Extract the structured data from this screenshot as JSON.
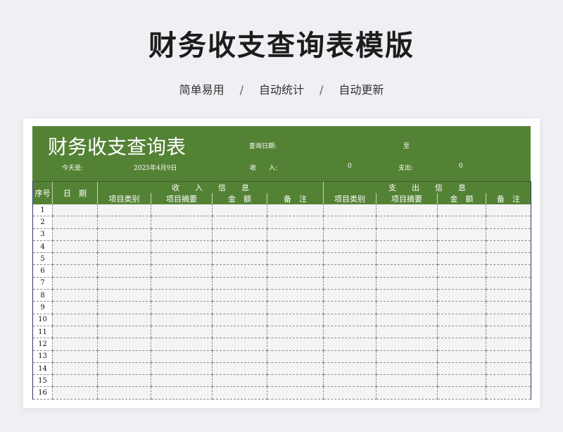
{
  "page": {
    "title": "财务收支查询表模版",
    "tags": [
      "简单易用",
      "自动统计",
      "自动更新"
    ],
    "tag_separator": "/"
  },
  "sheet": {
    "title": "财务收支查询表",
    "query_date_label": "查询日期:",
    "query_to": "至",
    "today_label": "今天是:",
    "today_value": "2025年4月9日",
    "income_label": "收　　入:",
    "income_value": "0",
    "expense_label": "支出:",
    "expense_value": "0"
  },
  "table": {
    "col_seq": "序号",
    "col_date": "日　期",
    "income_group": "收　　入　　信　　息",
    "expense_group": "支　　出　　信　　息",
    "income_cols": [
      "项目类别",
      "项目摘要",
      "金　额",
      "备　注"
    ],
    "expense_cols": [
      "项目类别",
      "项目摘要",
      "金　额",
      "备　注"
    ],
    "rows": [
      "1",
      "2",
      "3",
      "4",
      "5",
      "6",
      "7",
      "8",
      "9",
      "10",
      "11",
      "12",
      "13",
      "14",
      "15",
      "16"
    ]
  },
  "colors": {
    "banner": "#548235",
    "background": "#eef0f3"
  }
}
